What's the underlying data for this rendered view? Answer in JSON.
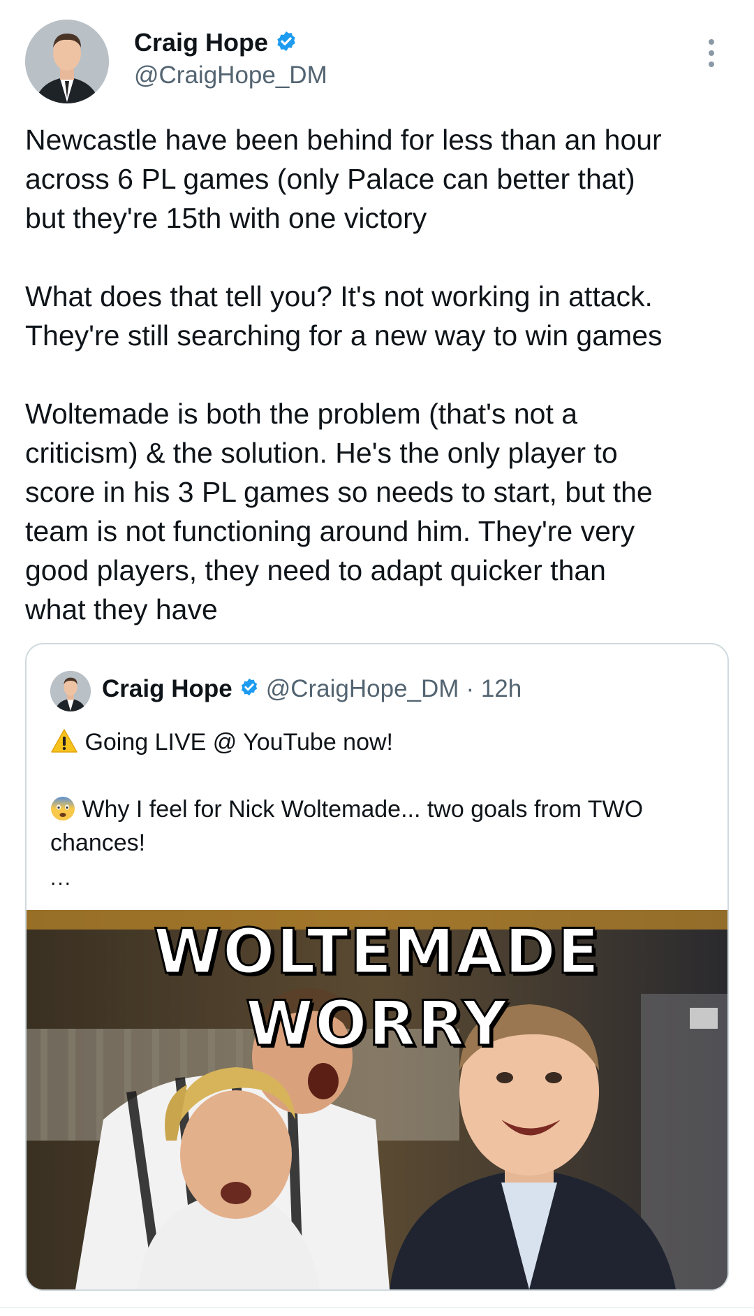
{
  "author": {
    "name": "Craig Hope",
    "handle": "@CraigHope_DM",
    "verified": true
  },
  "tweet": {
    "paragraphs": [
      [
        "Newcastle have been behind for less than an hour",
        "across 6 PL games (only Palace can better that)",
        "but they're 15th with one victory"
      ],
      [
        "What does that tell you? It's not working in attack.",
        "They're still searching for a new way to win games"
      ],
      [
        "Woltemade is both the problem (that's not a",
        "criticism) & the solution. He's the only player to",
        "score in his 3 PL games so needs to start, but the",
        "team is not functioning around him. They're very",
        "good players, they need to adapt quicker than",
        "what they have"
      ]
    ]
  },
  "quoted": {
    "name": "Craig Hope",
    "handle": "@CraigHope_DM",
    "time": "· 12h",
    "line1": "Going LIVE @ YouTube now!",
    "line2a": "Why I feel for Nick Woltemade... two goals from TWO",
    "line2b": "chances!",
    "ellipsis": "...",
    "media_title": "WOLTEMADE WORRY"
  },
  "icons": {
    "verified": "verified-badge-icon",
    "more": "more-options-icon",
    "warning": "warning-emoji",
    "fearful": "fearful-face-emoji"
  },
  "colors": {
    "verified_blue": "#1d9bf0",
    "muted_text": "#536471",
    "border": "#cfd9de"
  }
}
